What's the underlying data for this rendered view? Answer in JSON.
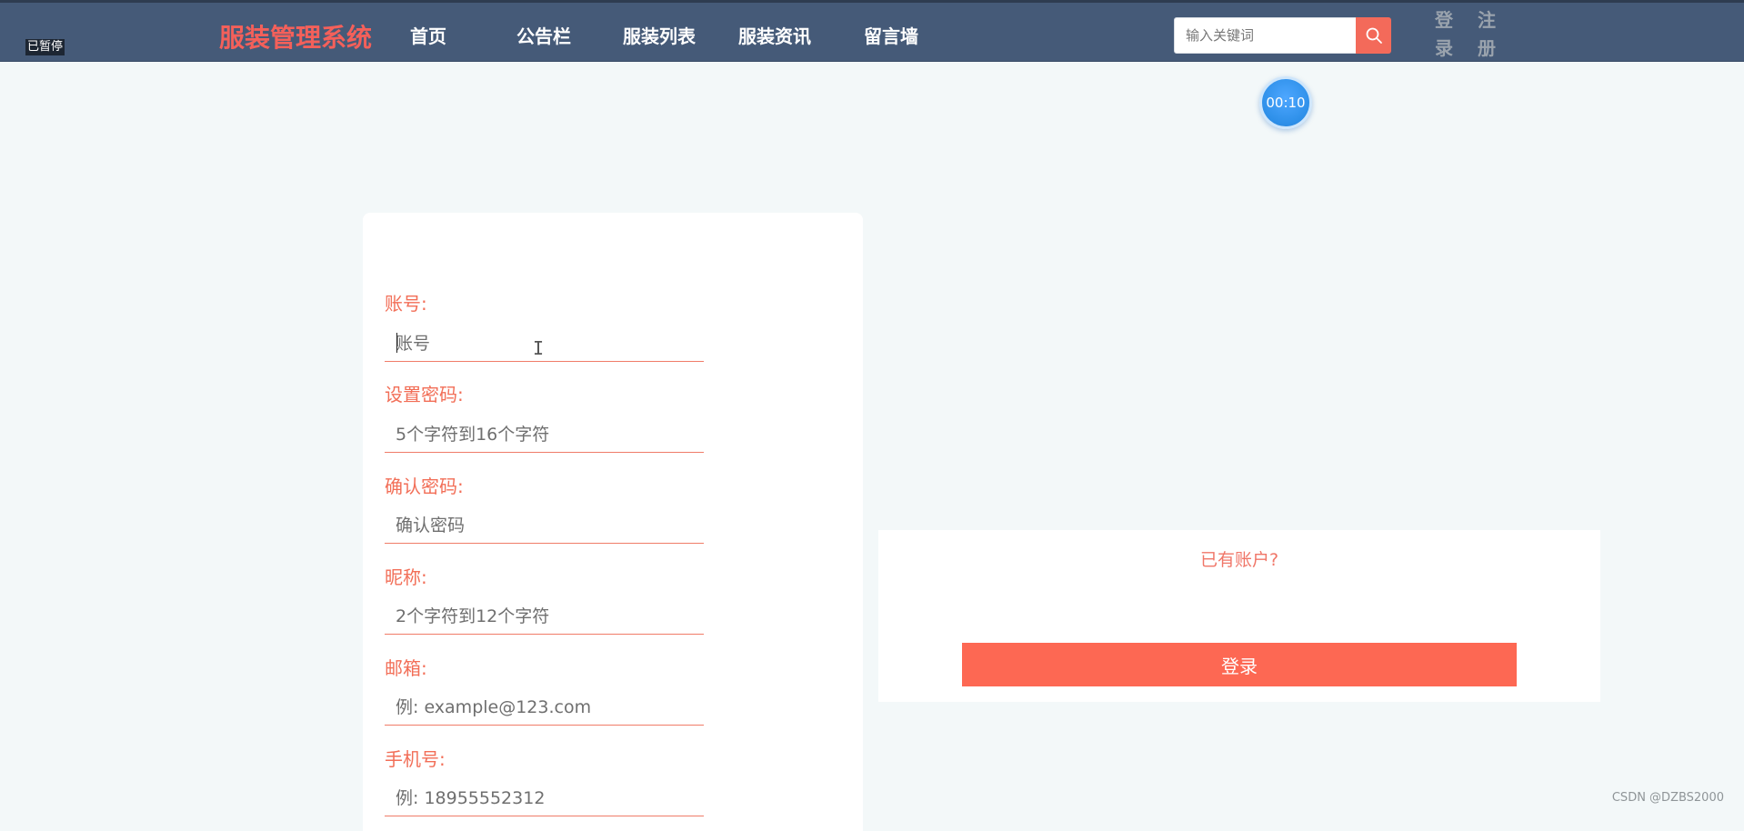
{
  "header": {
    "paused_label": "已暂停",
    "brand": "服装管理系统",
    "nav": [
      {
        "label": "首页"
      },
      {
        "label": "公告栏"
      },
      {
        "label": "服装列表"
      },
      {
        "label": "服装资讯"
      },
      {
        "label": "留言墙"
      }
    ],
    "search": {
      "placeholder": "输入关键词",
      "value": "",
      "icon": "search-icon"
    },
    "login_label": "登录",
    "register_label": "注册"
  },
  "timer": {
    "display": "00:10"
  },
  "register_form": {
    "fields": [
      {
        "label": "账号:",
        "placeholder": "账号"
      },
      {
        "label": "设置密码:",
        "placeholder": "5个字符到16个字符"
      },
      {
        "label": "确认密码:",
        "placeholder": "确认密码"
      },
      {
        "label": "昵称:",
        "placeholder": "2个字符到12个字符"
      },
      {
        "label": "邮箱:",
        "placeholder": "例: example@123.com"
      },
      {
        "label": "手机号:",
        "placeholder": "例: 18955552312"
      }
    ]
  },
  "login_panel": {
    "hint": "已有账户?",
    "button_label": "登录"
  },
  "watermark": "CSDN @DZBS2000",
  "colors": {
    "header_bg": "#455a78",
    "accent": "#f36a5a",
    "page_bg": "#f3f8f9"
  }
}
